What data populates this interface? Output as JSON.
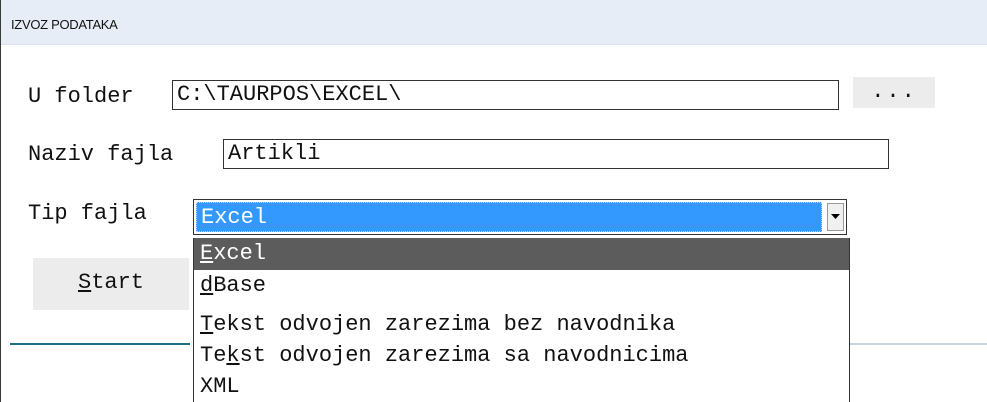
{
  "window": {
    "title": "IZVOZ PODATAKA"
  },
  "form": {
    "folder_label": "U folder",
    "folder_value": "C:\\TAURPOS\\EXCEL\\",
    "browse_label": "...",
    "filename_label": "Naziv fajla",
    "filename_value": "Artikli",
    "filetype_label": "Tip fajla",
    "filetype_selected": "Excel"
  },
  "start_button": {
    "accel": "S",
    "rest": "tart"
  },
  "dropdown": {
    "items": [
      {
        "pre": "",
        "accel": "E",
        "post": "xcel",
        "selected": true
      },
      {
        "pre": "",
        "accel": "d",
        "post": "Base",
        "selected": false
      },
      {
        "pre": "",
        "accel": "T",
        "post": "ekst odvojen zarezima bez navodnika",
        "selected": false
      },
      {
        "pre": "Te",
        "accel": "k",
        "post": "st odvojen zarezima sa navodnicima",
        "selected": false
      },
      {
        "pre": "XML",
        "accel": "",
        "post": "",
        "selected": false
      }
    ]
  },
  "colors": {
    "titlebar": "#e6edf6",
    "selection_blue": "#3399ff",
    "dropdown_highlight": "#5c5c5c",
    "separator": "#1e6e8c"
  }
}
